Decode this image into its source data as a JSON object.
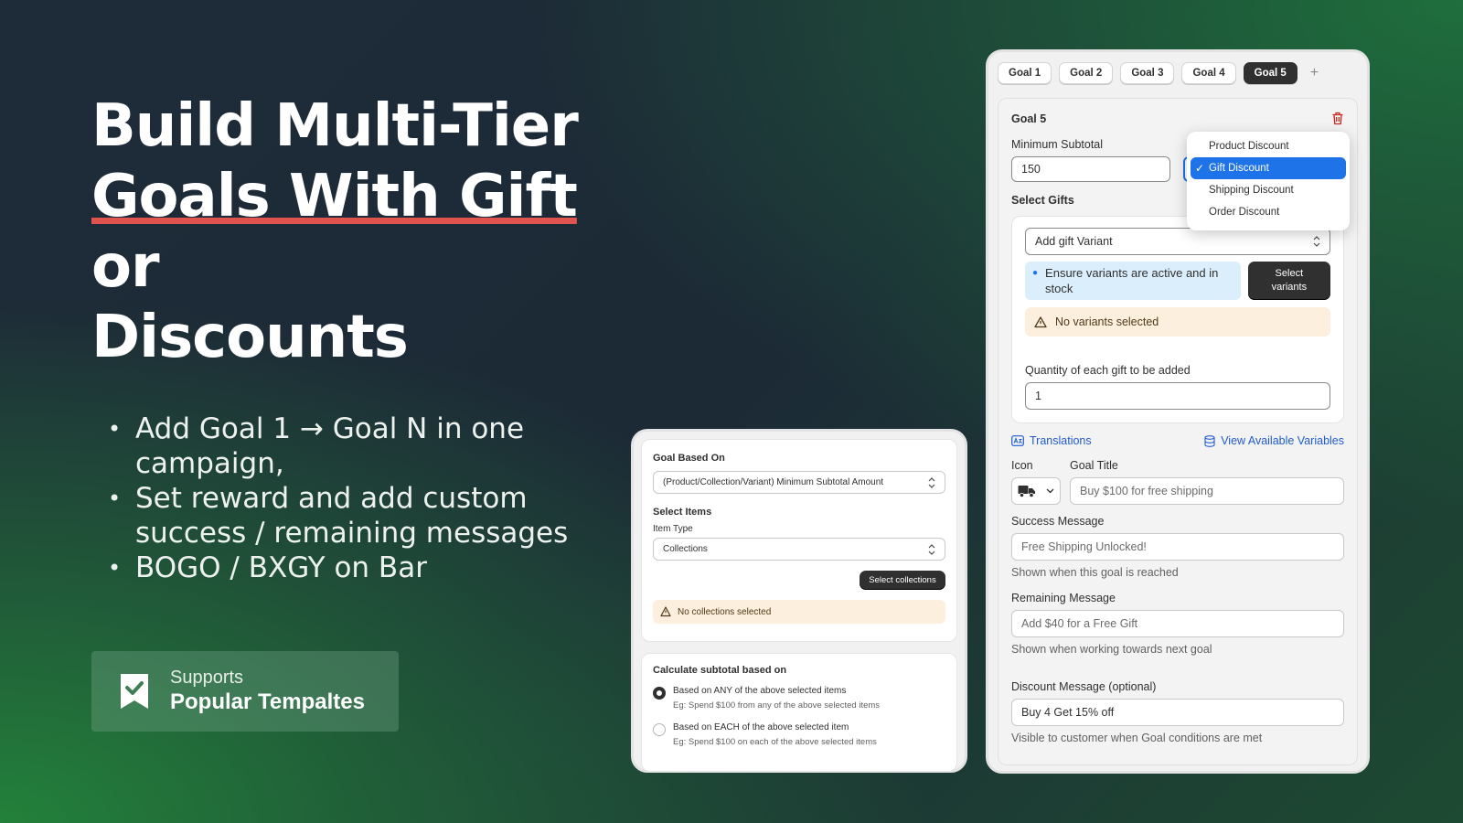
{
  "headline": {
    "line1": "Build Multi-Tier",
    "line2_underlined": "Goals With Gift",
    "line2_rest": " or",
    "line3": "Discounts"
  },
  "bullets": [
    "Add Goal 1 → Goal N in one campaign,",
    "Set reward and add custom success / remaining messages",
    "BOGO / BXGY on Bar"
  ],
  "badge": {
    "icon": "bookmark-check-icon",
    "line1": "Supports",
    "line2": "Popular Tempaltes"
  },
  "left_card": {
    "goal_based_on_label": "Goal Based On",
    "goal_based_on_value": "(Product/Collection/Variant) Minimum Subtotal Amount",
    "select_items_label": "Select Items",
    "item_type_label": "Item Type",
    "item_type_value": "Collections",
    "select_collections_button": "Select collections",
    "no_collections_warning": "No collections selected",
    "calc_label": "Calculate subtotal based on",
    "options": [
      {
        "label": "Based on ANY of the above selected items",
        "help": "Eg: Spend $100 from any of the above selected items",
        "selected": true
      },
      {
        "label": "Based on EACH of the above selected item",
        "help": "Eg: Spend $100 on each of the above selected items",
        "selected": false
      }
    ]
  },
  "right_card": {
    "tabs": [
      "Goal 1",
      "Goal 2",
      "Goal 3",
      "Goal 4",
      "Goal 5"
    ],
    "active_tab": "Goal 5",
    "goal_title_heading": "Goal 5",
    "min_subtotal_label": "Minimum Subtotal",
    "min_subtotal_value": "150",
    "discount_options": [
      "Product Discount",
      "Gift Discount",
      "Shipping Discount",
      "Order Discount"
    ],
    "selected_discount": "Gift Discount",
    "select_gifts_label": "Select Gifts",
    "gift_variant_select": "Add gift Variant",
    "info_text": "Ensure variants are active and in stock",
    "select_variants_button": "Select variants",
    "no_variants_warning": "No variants selected",
    "quantity_label": "Quantity of each gift to be added",
    "quantity_value": "1",
    "translations_link": "Translations",
    "variables_link": "View Available Variables",
    "icon_label": "Icon",
    "icon_value": "truck-icon",
    "goal_title_label": "Goal Title",
    "goal_title_placeholder": "Buy $100 for free shipping",
    "success_label": "Success Message",
    "success_placeholder": "Free Shipping Unlocked!",
    "success_help": "Shown when this goal is reached",
    "remaining_label": "Remaining Message",
    "remaining_placeholder": "Add $40 for a Free Gift",
    "remaining_help": "Shown when working towards next goal",
    "discount_msg_label": "Discount Message (optional)",
    "discount_msg_value": "Buy 4 Get 15% off",
    "discount_msg_help": "Visible to customer when Goal conditions are met"
  }
}
